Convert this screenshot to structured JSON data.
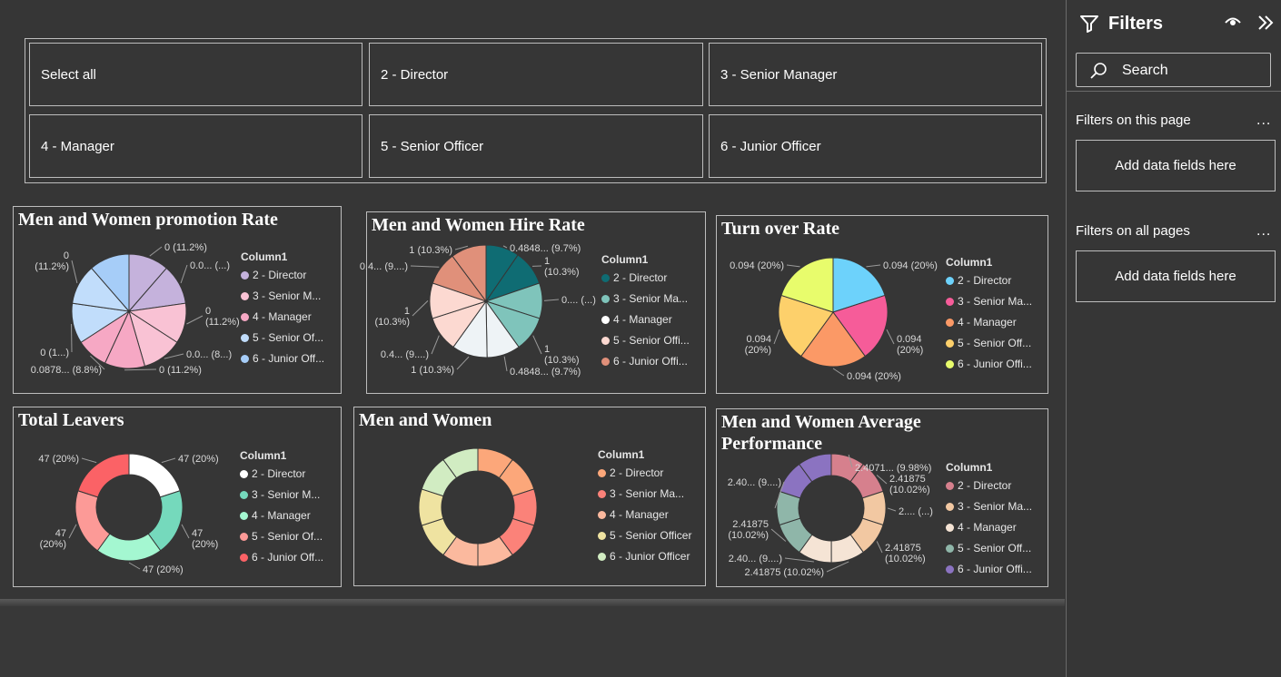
{
  "slicer": {
    "items": [
      "Select all",
      "2 - Director",
      "3 - Senior Manager",
      "4 - Manager",
      "5 - Senior Officer",
      "6 - Junior Officer"
    ]
  },
  "filters": {
    "title": "Filters",
    "search_placeholder": "Search",
    "this_page_label": "Filters on this page",
    "all_pages_label": "Filters on all pages",
    "more_label": "...",
    "add_fields_label": "Add data fields here"
  },
  "colors": {
    "background": "#363636",
    "border": "#bdbdbd"
  },
  "chart_data": [
    {
      "id": "promotion",
      "type": "pie",
      "title": "Men and Women promotion Rate",
      "legend_title": "Column1",
      "legend_position": "right",
      "legend": [
        "2 - Director",
        "3 - Senior M...",
        "4 - Manager",
        "5 - Senior Of...",
        "6 - Junior Off..."
      ],
      "legend_colors": [
        "#c5b2dc",
        "#f9c2d4",
        "#f6a8c4",
        "#c1ddfb",
        "#a6cdf8"
      ],
      "slice_values": [
        0.112,
        0.112,
        0.112,
        0.112,
        0.112,
        0.088,
        0.112,
        0.112,
        0.112
      ],
      "slice_colors": [
        "#c5b2dc",
        "#c5b2dc",
        "#f9c2d4",
        "#f9c2d4",
        "#f6a8c4",
        "#f6a8c4",
        "#c1ddfb",
        "#c1ddfb",
        "#a6cdf8"
      ],
      "labels": [
        "0 (11.2%)",
        "0.0... (...)",
        "0\n(11.2%)",
        "0.0... (8...)",
        "0 (11.2%)",
        "0.0878... (8.8%)",
        "0 (1...)",
        "0\n(11.2%)"
      ]
    },
    {
      "id": "hire",
      "type": "pie",
      "title": "Men and Women Hire Rate",
      "legend_title": "Column1",
      "legend_position": "right",
      "legend": [
        "2 - Director",
        "3 - Senior Ma...",
        "4 - Manager",
        "5 - Senior Offi...",
        "6 - Junior Offi..."
      ],
      "legend_colors": [
        "#0f6c73",
        "#7fc4bb",
        "#ffffff",
        "#fcd9d1",
        "#e0907a"
      ],
      "slice_values": [
        0.097,
        0.103,
        0.103,
        0.103,
        0.097,
        0.103,
        0.103,
        0.103,
        0.097,
        0.103
      ],
      "slice_colors": [
        "#0f6c73",
        "#0f6c73",
        "#7fc4bb",
        "#7fc4bb",
        "#eef3f6",
        "#eef3f6",
        "#fcd9d1",
        "#fcd9d1",
        "#e0907a",
        "#e0907a"
      ],
      "labels": [
        "0.4848... (9.7%)",
        "1\n(10.3%)",
        "0.... (...)",
        "1\n(10.3%)",
        "0.4848... (9.7%)",
        "1 (10.3%)",
        "0.4... (9....)",
        "1\n(10.3%)",
        "0.4... (9....)",
        "1 (10.3%)"
      ]
    },
    {
      "id": "turnover",
      "type": "pie",
      "title": "Turn over Rate",
      "legend_title": "Column1",
      "legend_position": "right",
      "legend": [
        "2 - Director",
        "3 - Senior Ma...",
        "4 - Manager",
        "5 - Senior Off...",
        "6 - Junior Offi..."
      ],
      "legend_colors": [
        "#6dd2fb",
        "#f65c99",
        "#fb9966",
        "#fdd06b",
        "#e8fc6c"
      ],
      "slice_values": [
        0.2,
        0.2,
        0.2,
        0.2,
        0.2
      ],
      "slice_colors": [
        "#6dd2fb",
        "#f65c99",
        "#fb9966",
        "#fdd06b",
        "#e8fc6c"
      ],
      "labels": [
        "0.094 (20%)",
        "0.094\n(20%)",
        "0.094 (20%)",
        "0.094\n(20%)",
        "0.094 (20%)"
      ]
    },
    {
      "id": "leavers",
      "type": "donut",
      "title": "Total Leavers",
      "legend_title": "Column1",
      "legend_position": "right",
      "legend": [
        "2 - Director",
        "3 - Senior M...",
        "4 - Manager",
        "5 - Senior Of...",
        "6 - Junior Off..."
      ],
      "legend_colors": [
        "#ffffff",
        "#75d9bc",
        "#a4f7d1",
        "#fc9a97",
        "#fb6266"
      ],
      "slice_values": [
        47,
        47,
        47,
        47,
        47
      ],
      "slice_colors": [
        "#ffffff",
        "#75d9bc",
        "#a4f7d1",
        "#fc9a97",
        "#fb6266"
      ],
      "labels": [
        "47 (20%)",
        "47\n(20%)",
        "47 (20%)",
        "47\n(20%)",
        "47 (20%)"
      ]
    },
    {
      "id": "menwomen",
      "type": "donut",
      "title": "Men and Women",
      "legend_title": "Column1",
      "legend_position": "right",
      "legend": [
        "2 - Director",
        "3 - Senior Ma...",
        "4 - Manager",
        "5 - Senior Officer",
        "6 - Junior Officer"
      ],
      "legend_colors": [
        "#fca77a",
        "#fb8279",
        "#fbb99e",
        "#efe3a1",
        "#d1ecc2"
      ],
      "slice_values": [
        1,
        1,
        1,
        1,
        1,
        1,
        1,
        1,
        1,
        1
      ],
      "slice_colors": [
        "#fca77a",
        "#fca77a",
        "#fb8279",
        "#fb8279",
        "#fbb99e",
        "#fbb99e",
        "#efe3a1",
        "#efe3a1",
        "#d1ecc2",
        "#d1ecc2"
      ],
      "labels": []
    },
    {
      "id": "performance",
      "type": "donut",
      "title": "Men and Women Average Performance",
      "legend_title": "Column1",
      "legend_position": "right",
      "legend": [
        "2 - Director",
        "3 - Senior Ma...",
        "4 - Manager",
        "5 - Senior Off...",
        "6 - Junior Offi..."
      ],
      "legend_colors": [
        "#d6808d",
        "#f2c8a2",
        "#f5e4d5",
        "#8fb6a9",
        "#8b73c1"
      ],
      "slice_values": [
        0.0998,
        0.1002,
        0.1002,
        0.1002,
        0.0998,
        0.1002,
        0.1002,
        0.1002,
        0.0998,
        0.1002
      ],
      "slice_colors": [
        "#d6808d",
        "#d6808d",
        "#f2c8a2",
        "#f2c8a2",
        "#f5e4d5",
        "#f5e4d5",
        "#8fb6a9",
        "#8fb6a9",
        "#8b73c1",
        "#8b73c1"
      ],
      "labels": [
        "2.4071... (9.98%)",
        "2.41875\n(10.02%)",
        "2.... (...)",
        "2.41875\n(10.02%)",
        "2.41875 (10.02%)",
        "2.40... (9....)",
        "2.41875\n(10.02%)",
        "2.40... (9....)"
      ]
    }
  ]
}
